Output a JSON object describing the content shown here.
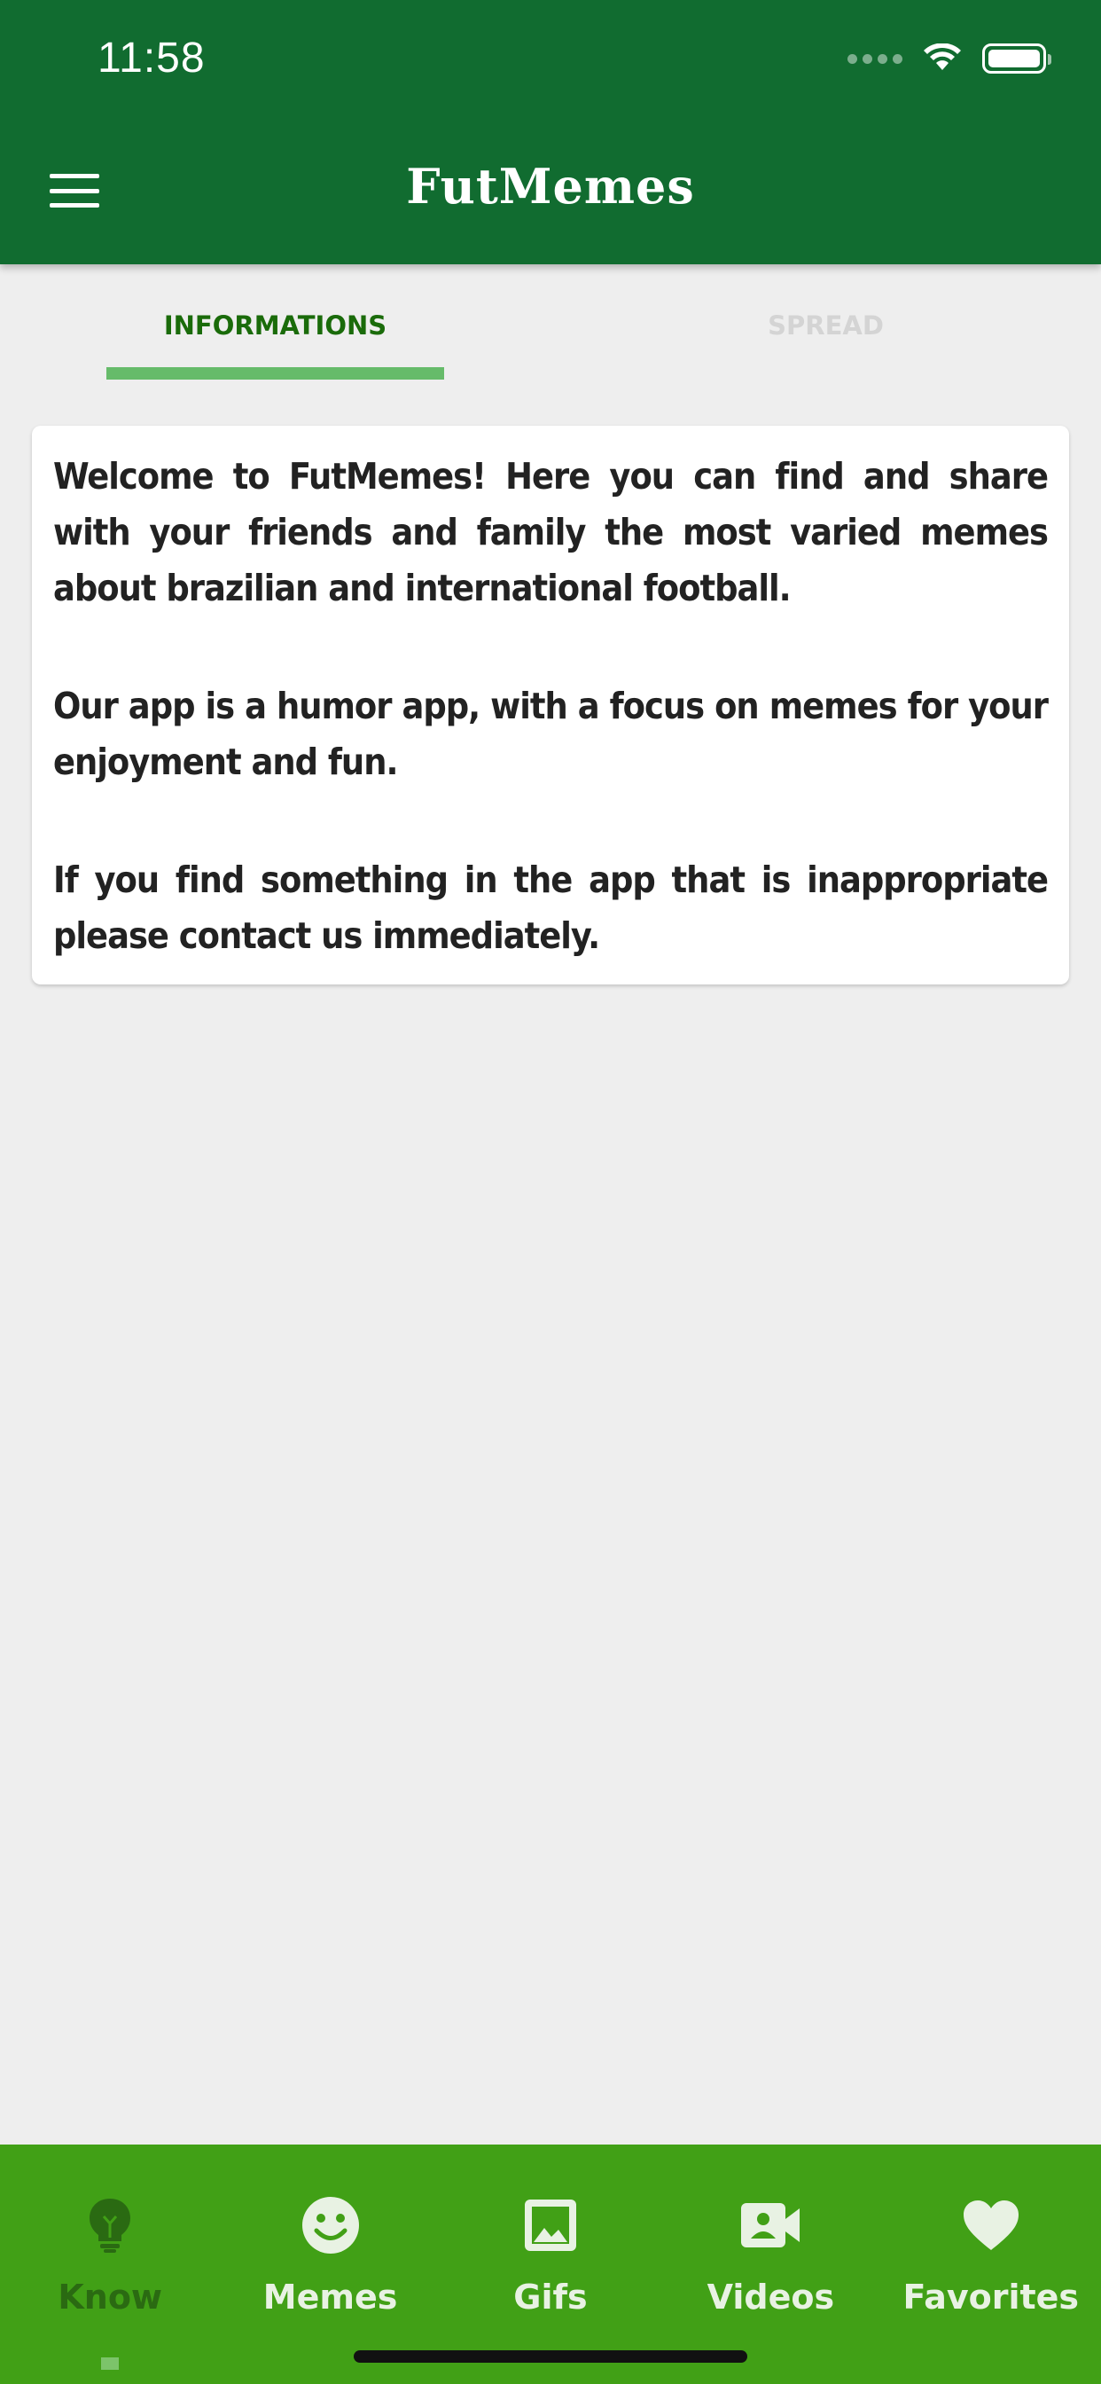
{
  "status_bar": {
    "time": "11:58"
  },
  "header": {
    "title": "FutMemes",
    "menu_icon": "hamburger-menu-icon",
    "background": "#116c30"
  },
  "tabs": [
    {
      "label": "INFORMATIONS",
      "active": true
    },
    {
      "label": "SPREAD",
      "active": false
    }
  ],
  "tab_indicator_color": "#66bb6a",
  "card": {
    "paragraphs": [
      "Welcome to FutMemes! Here you can find and share with your friends and family the most varied memes about brazilian and international football.",
      "Our app is a humor app, with a focus on memes for your enjoyment and fun.",
      "If you find something in the app that is inappropriate please contact us immediately."
    ]
  },
  "bottom_nav": {
    "background": "#41a016",
    "items": [
      {
        "label": "Know",
        "icon": "lightbulb-icon",
        "active": true
      },
      {
        "label": "Memes",
        "icon": "smiley-face-icon",
        "active": false
      },
      {
        "label": "Gifs",
        "icon": "image-icon",
        "active": false
      },
      {
        "label": "Videos",
        "icon": "video-camera-icon",
        "active": false
      },
      {
        "label": "Favorites",
        "icon": "heart-icon",
        "active": false
      }
    ]
  }
}
